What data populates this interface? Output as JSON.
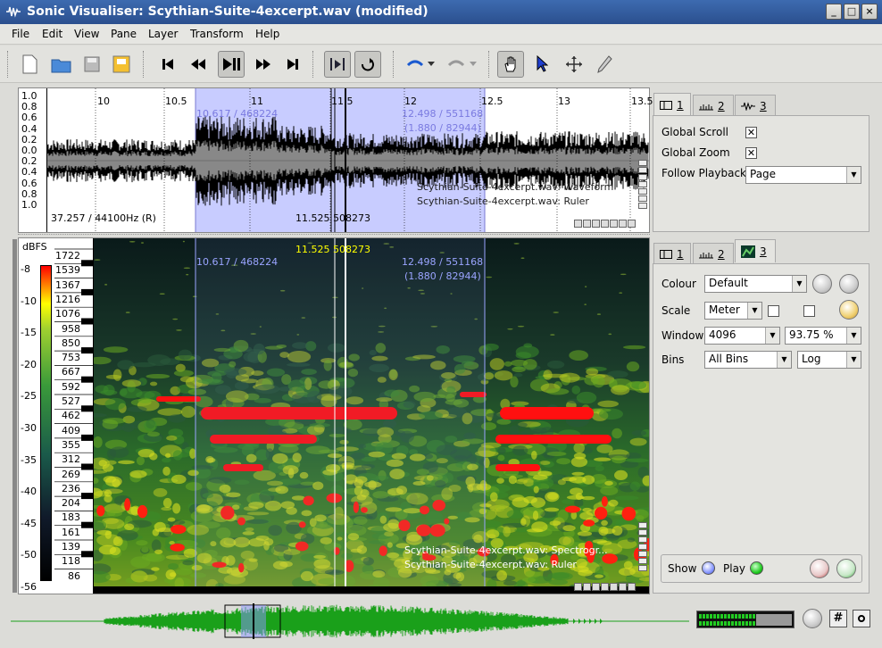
{
  "window": {
    "title": "Sonic Visualiser: Scythian-Suite-4excerpt.wav (modified)"
  },
  "menu": [
    "File",
    "Edit",
    "View",
    "Pane",
    "Layer",
    "Transform",
    "Help"
  ],
  "waveform_pane": {
    "y_ticks": [
      "1.0",
      "0.8",
      "0.6",
      "0.4",
      "0.2",
      "0.0",
      "0.2",
      "0.4",
      "0.6",
      "0.8",
      "1.0"
    ],
    "x_ticks": [
      "10",
      "10.5",
      "11",
      "11.5",
      "12",
      "12.5",
      "13",
      "13.5"
    ],
    "sel_start": "10.617 / 468224",
    "sel_end": "12.498 / 551168",
    "sel_dur": "(1.880 / 82944)",
    "cursor_label": "11.525  508273",
    "rate_label": "37.257 / 44100Hz (R)",
    "layers": [
      "Scythian-Suite-4excerpt.wav: Waveform",
      "Scythian-Suite-4excerpt.wav: Ruler"
    ]
  },
  "spectrogram_pane": {
    "unit": "dBFS",
    "db_ticks": [
      "-8",
      "-10",
      "-15",
      "-20",
      "-25",
      "-30",
      "-35",
      "-40",
      "-45",
      "-50",
      "-56"
    ],
    "freq_ticks": [
      "1722",
      "1539",
      "1367",
      "1216",
      "1076",
      "958",
      "850",
      "753",
      "667",
      "592",
      "527",
      "462",
      "409",
      "355",
      "312",
      "269",
      "236",
      "204",
      "183",
      "161",
      "139",
      "118",
      "86"
    ],
    "cursor_label": "11.525  508273",
    "sel_start": "10.617 / 468224",
    "sel_end": "12.498 / 551168",
    "sel_dur": "(1.880 / 82944)",
    "layers": [
      "Scythian-Suite-4excerpt.wav: Spectrogr...",
      "Scythian-Suite-4excerpt.wav: Ruler"
    ]
  },
  "top_panel": {
    "tabs": [
      "1",
      "2",
      "3"
    ],
    "global_scroll": "Global Scroll",
    "global_zoom": "Global Zoom",
    "follow_playback": "Follow Playback",
    "follow_value": "Page"
  },
  "bottom_panel": {
    "tabs": [
      "1",
      "2",
      "3"
    ],
    "colour_label": "Colour",
    "colour_value": "Default",
    "scale_label": "Scale",
    "scale_value": "Meter",
    "window_label": "Window",
    "window_value": "4096",
    "overlap_value": "93.75 %",
    "bins_label": "Bins",
    "bins_value": "All Bins",
    "bins_scale": "Log",
    "show_label": "Show",
    "play_label": "Play"
  },
  "colors": {
    "accent": "#2b4f8e",
    "selection": "#a0aaff",
    "wave": "#000000",
    "overview": "#1aa01a"
  }
}
